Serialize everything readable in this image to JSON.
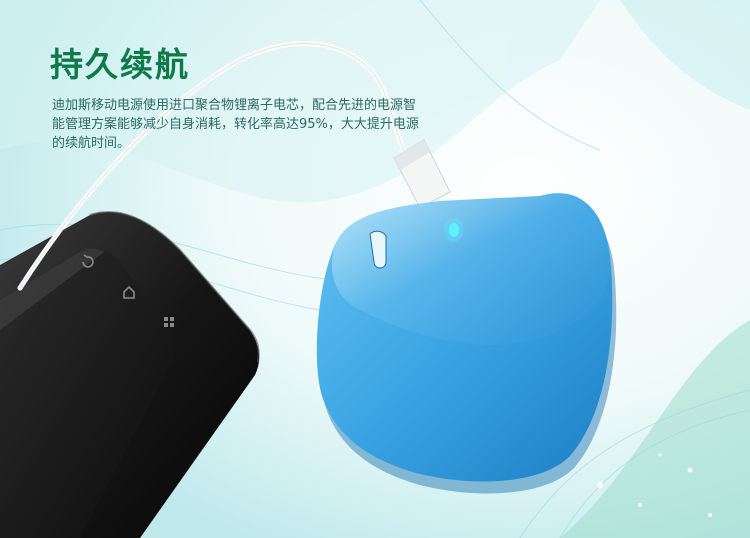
{
  "promo": {
    "headline": "持久续航",
    "description_lines": [
      "迪加斯移动电源使用进口聚合物锂离子电芯，配合先进的电源智",
      "能管理方案能够减少自身消耗，转化率高达95%，大大提升电源",
      "的续航时间。"
    ]
  },
  "colors": {
    "headline": "#0e7a48",
    "body_text": "#2c6a63",
    "power_bank": "#3fa8e4",
    "indicator_light": "#5cf3ff"
  },
  "icons": [
    "back-icon",
    "home-icon",
    "menu-icon"
  ]
}
